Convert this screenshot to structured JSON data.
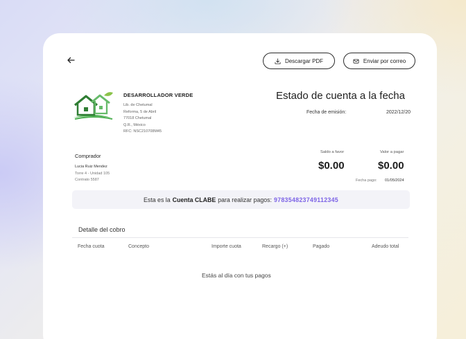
{
  "header": {
    "back_icon": "arrow-left-icon",
    "download_pdf_label": "Descargar PDF",
    "send_email_label": "Enviar por correo"
  },
  "company": {
    "name": "DESARROLLADOR VERDE",
    "address_lines": [
      "Lib. de Chetumal",
      "Reforma, 5 de Abril",
      "77018 Chetumal",
      "Q.R., México",
      "RFC: NSC210708M45"
    ],
    "logo_colors": {
      "house": "#2e7d32",
      "leaf": "#8bc34a",
      "ground": "#4caf50"
    }
  },
  "statement": {
    "title": "Estado de cuenta a la fecha",
    "emission_label": "Fecha de emisión:",
    "emission_value": "2022/12/20"
  },
  "buyer": {
    "label": "Comprador",
    "name": "Lucia Ruiz Mendez",
    "unit": "Torre 4 - Unidad 105",
    "contract": "Contrato 5587"
  },
  "summary": {
    "balance_label": "Saldo a favor",
    "balance_value": "$0.00",
    "due_label": "Valor a pagar",
    "due_value": "$0.00",
    "pay_date_label": "Fecha pago:",
    "pay_date_value": "01/05/2024"
  },
  "clabe": {
    "prefix": "Esta es la",
    "emph": "Cuenta CLABE",
    "suffix": "para realizar pagos:",
    "number": "978354823749112345",
    "accent_color": "#7c63e6"
  },
  "detail": {
    "title": "Detalle del cobro",
    "columns": [
      "Fecha cuota",
      "Concepto",
      "Importe cuota",
      "Recargo (+)",
      "Pagado",
      "Adeudo total"
    ],
    "empty_message": "Estás al día con tus pagos"
  }
}
